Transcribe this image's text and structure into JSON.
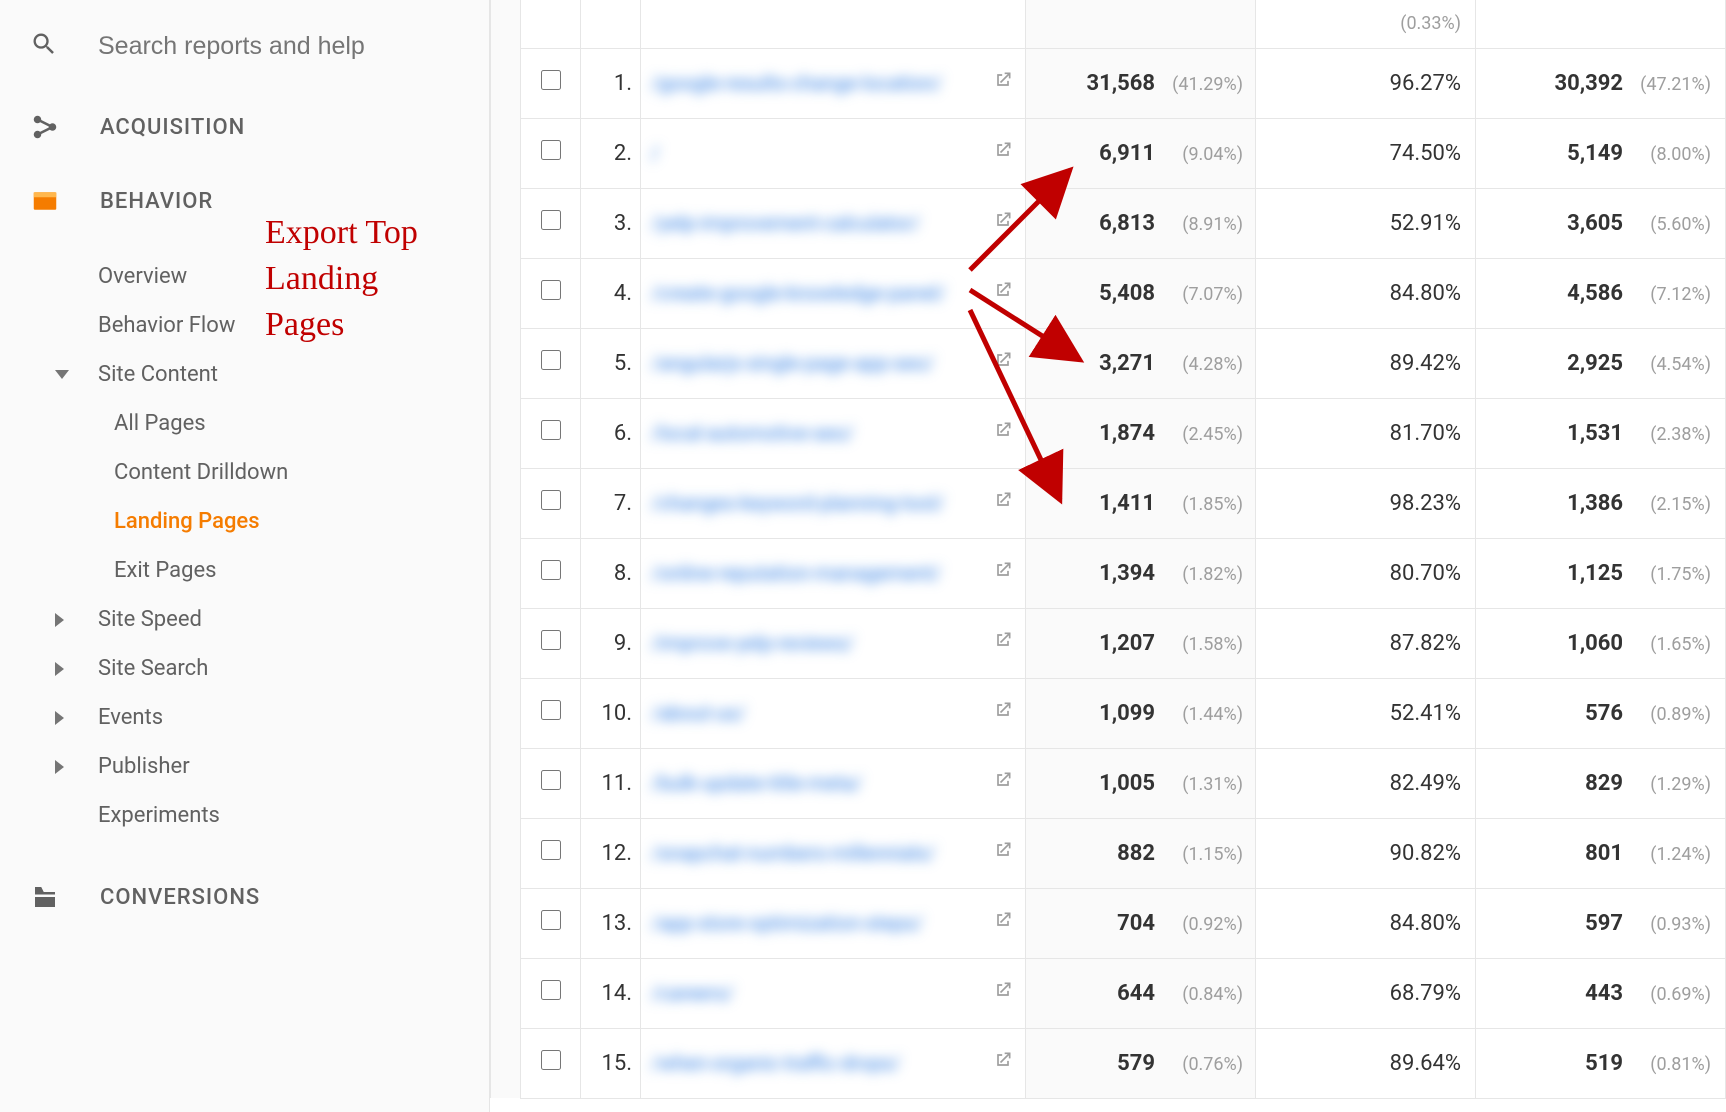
{
  "search": {
    "placeholder": "Search reports and help"
  },
  "nav": {
    "acquisition": "ACQUISITION",
    "behavior": "BEHAVIOR",
    "conversions": "CONVERSIONS",
    "overview": "Overview",
    "behavior_flow": "Behavior Flow",
    "site_content": "Site Content",
    "all_pages": "All Pages",
    "content_drilldown": "Content Drilldown",
    "landing_pages": "Landing Pages",
    "exit_pages": "Exit Pages",
    "site_speed": "Site Speed",
    "site_search": "Site Search",
    "events": "Events",
    "publisher": "Publisher",
    "experiments": "Experiments"
  },
  "annotation": "Export Top\nLanding\nPages",
  "header_pct": "(0.33%)",
  "rows": [
    {
      "idx": "1.",
      "page_blur": "/google-results-change-location/",
      "sessions": "31,568",
      "spct": "(41.29%)",
      "pct": "96.27%",
      "newsess": "30,392",
      "npct": "(47.21%)"
    },
    {
      "idx": "2.",
      "page_blur": "/",
      "sessions": "6,911",
      "spct": "(9.04%)",
      "pct": "74.50%",
      "newsess": "5,149",
      "npct": "(8.00%)"
    },
    {
      "idx": "3.",
      "page_blur": "/yelp-improvement-calculator/",
      "sessions": "6,813",
      "spct": "(8.91%)",
      "pct": "52.91%",
      "newsess": "3,605",
      "npct": "(5.60%)"
    },
    {
      "idx": "4.",
      "page_blur": "/create-google-knowledge-panel/",
      "sessions": "5,408",
      "spct": "(7.07%)",
      "pct": "84.80%",
      "newsess": "4,586",
      "npct": "(7.12%)"
    },
    {
      "idx": "5.",
      "page_blur": "/angularjs-single-page-app-seo/",
      "sessions": "3,271",
      "spct": "(4.28%)",
      "pct": "89.42%",
      "newsess": "2,925",
      "npct": "(4.54%)"
    },
    {
      "idx": "6.",
      "page_blur": "/local-automotive-seo/",
      "sessions": "1,874",
      "spct": "(2.45%)",
      "pct": "81.70%",
      "newsess": "1,531",
      "npct": "(2.38%)"
    },
    {
      "idx": "7.",
      "page_blur": "/changes-keyword-planning-tool/",
      "sessions": "1,411",
      "spct": "(1.85%)",
      "pct": "98.23%",
      "newsess": "1,386",
      "npct": "(2.15%)"
    },
    {
      "idx": "8.",
      "page_blur": "/online-reputation-management/",
      "sessions": "1,394",
      "spct": "(1.82%)",
      "pct": "80.70%",
      "newsess": "1,125",
      "npct": "(1.75%)"
    },
    {
      "idx": "9.",
      "page_blur": "/improve-yelp-reviews/",
      "sessions": "1,207",
      "spct": "(1.58%)",
      "pct": "87.82%",
      "newsess": "1,060",
      "npct": "(1.65%)"
    },
    {
      "idx": "10.",
      "page_blur": "/about-us/",
      "sessions": "1,099",
      "spct": "(1.44%)",
      "pct": "52.41%",
      "newsess": "576",
      "npct": "(0.89%)"
    },
    {
      "idx": "11.",
      "page_blur": "/bulk-update-title-meta/",
      "sessions": "1,005",
      "spct": "(1.31%)",
      "pct": "82.49%",
      "newsess": "829",
      "npct": "(1.29%)"
    },
    {
      "idx": "12.",
      "page_blur": "/snapchat-numbers-millennials/",
      "sessions": "882",
      "spct": "(1.15%)",
      "pct": "90.82%",
      "newsess": "801",
      "npct": "(1.24%)"
    },
    {
      "idx": "13.",
      "page_blur": "/app-store-optimization-steps/",
      "sessions": "704",
      "spct": "(0.92%)",
      "pct": "84.80%",
      "newsess": "597",
      "npct": "(0.93%)"
    },
    {
      "idx": "14.",
      "page_blur": "/careers/",
      "sessions": "644",
      "spct": "(0.84%)",
      "pct": "68.79%",
      "newsess": "443",
      "npct": "(0.69%)"
    },
    {
      "idx": "15.",
      "page_blur": "/when-organic-traffic-drops/",
      "sessions": "579",
      "spct": "(0.76%)",
      "pct": "89.64%",
      "newsess": "519",
      "npct": "(0.81%)"
    }
  ]
}
